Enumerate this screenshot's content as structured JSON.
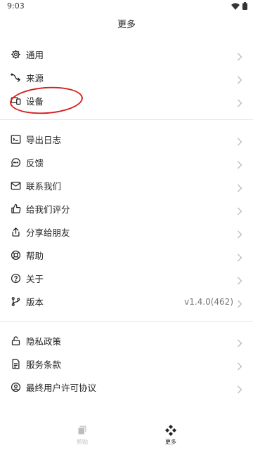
{
  "status_bar": {
    "time": "9:03"
  },
  "header": {
    "title": "更多"
  },
  "sections": [
    {
      "items": [
        {
          "label": "通用",
          "icon": "gear-icon"
        },
        {
          "label": "来源",
          "icon": "source-icon"
        },
        {
          "label": "设备",
          "icon": "devices-icon"
        }
      ]
    },
    {
      "items": [
        {
          "label": "导出日志",
          "icon": "terminal-icon"
        },
        {
          "label": "反馈",
          "icon": "chat-bubble-icon"
        },
        {
          "label": "联系我们",
          "icon": "mail-icon"
        },
        {
          "label": "给我们评分",
          "icon": "thumbs-up-icon"
        },
        {
          "label": "分享给朋友",
          "icon": "share-icon"
        },
        {
          "label": "帮助",
          "icon": "lifebuoy-icon"
        },
        {
          "label": "关于",
          "icon": "help-circle-icon"
        },
        {
          "label": "版本",
          "icon": "git-branch-icon",
          "value": "v1.4.0(462)"
        }
      ]
    },
    {
      "items": [
        {
          "label": "隐私政策",
          "icon": "lock-icon"
        },
        {
          "label": "服务条款",
          "icon": "document-icon"
        },
        {
          "label": "最终用户许可协议",
          "icon": "user-circle-icon"
        }
      ]
    }
  ],
  "bottom_nav": [
    {
      "label": "剪贴",
      "icon": "clipboard-stack-icon",
      "active": false
    },
    {
      "label": "更多",
      "icon": "diamond-grid-icon",
      "active": true
    }
  ],
  "colors": {
    "annotation": "#d61f1f",
    "divider": "#e6e6e6",
    "secondary_text": "#777777"
  }
}
